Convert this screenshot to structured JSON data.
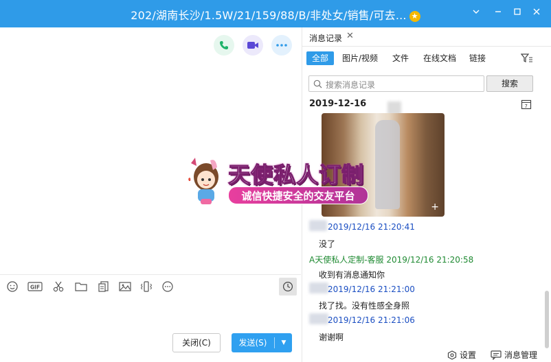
{
  "window": {
    "title": "202/湖南长沙/1.5W/21/159/88/B/非处女/销售/可去...",
    "accent_color": "#2f9be8",
    "controls": [
      "chevron-down-icon",
      "minimize-icon",
      "maximize-icon",
      "close-icon"
    ]
  },
  "chat_header": {
    "buttons": [
      {
        "name": "voice-call",
        "icon": "phone-icon"
      },
      {
        "name": "video-call",
        "icon": "video-camera-icon"
      },
      {
        "name": "more",
        "icon": "more-icon"
      }
    ]
  },
  "input_toolbar": {
    "tools": [
      "emoji-icon",
      "gif-icon",
      "screenshot-scissors-icon",
      "folder-icon",
      "doc-icon",
      "image-icon",
      "shake-icon",
      "more-options-icon"
    ],
    "history_icon": "clock-icon"
  },
  "actions": {
    "close_label": "关闭(C)",
    "send_label": "发送(S)"
  },
  "watermark": {
    "line1": "天使私人订制",
    "line2": "诚信快捷安全的交友平台"
  },
  "history": {
    "tab_label": "消息记录",
    "filters": [
      "全部",
      "图片/视频",
      "文件",
      "在线文档",
      "链接"
    ],
    "active_filter": "全部",
    "search_placeholder": "搜索消息记录",
    "search_button": "搜索",
    "date_header": "2019-12-16",
    "messages": [
      {
        "sender": "",
        "time": "2019/12/16 21:20:41",
        "text": "没了",
        "type": "user"
      },
      {
        "sender": "A天使私人定制-客服",
        "time": "2019/12/16 21:20:58",
        "text": "收到有消息通知你",
        "type": "service"
      },
      {
        "sender": "",
        "time": "2019/12/16 21:21:00",
        "text": "找了找。没有性感全身照",
        "type": "user"
      },
      {
        "sender": "",
        "time": "2019/12/16 21:21:06",
        "text": "谢谢啊",
        "type": "user"
      }
    ],
    "footer": {
      "settings_label": "设置",
      "manage_label": "消息管理"
    }
  }
}
